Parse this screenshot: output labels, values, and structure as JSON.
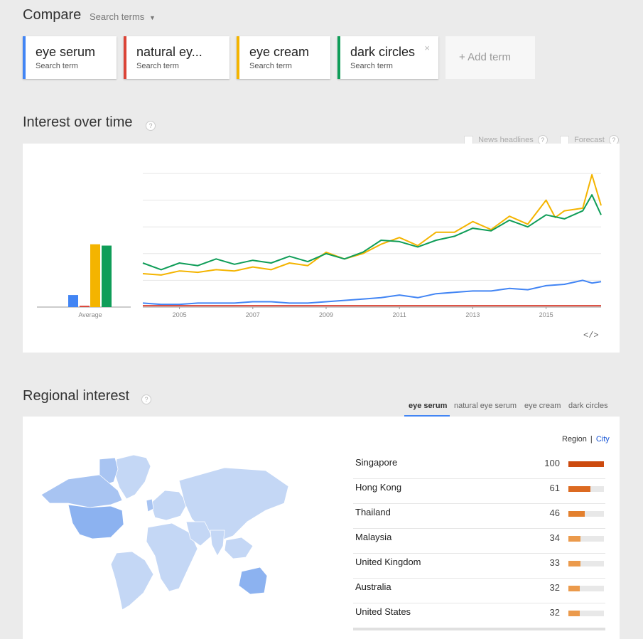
{
  "header": {
    "title": "Compare",
    "search_terms_label": "Search terms"
  },
  "terms": [
    {
      "name": "eye serum",
      "type": "Search term",
      "color": "#4285f4"
    },
    {
      "name": "natural ey...",
      "type": "Search term",
      "color": "#db4437"
    },
    {
      "name": "eye cream",
      "type": "Search term",
      "color": "#f4b400"
    },
    {
      "name": "dark circles",
      "type": "Search term",
      "color": "#0f9d58",
      "close": "×"
    }
  ],
  "add_term_label": "+ Add term",
  "interest": {
    "title": "Interest over time",
    "help": "?",
    "news_headlines_label": "News headlines",
    "forecast_label": "Forecast",
    "embed_icon": "</>"
  },
  "chart_data": {
    "type": "line",
    "xlabel": "",
    "ylabel": "",
    "x_ticks": [
      "2005",
      "2007",
      "2009",
      "2011",
      "2013",
      "2015"
    ],
    "x_range": [
      2004.0,
      2016.5
    ],
    "ylim": [
      0,
      100
    ],
    "grid": true,
    "average": {
      "label": "Average",
      "values": [
        9,
        1,
        47,
        46
      ]
    },
    "series": [
      {
        "name": "eye serum",
        "color": "#4285f4",
        "x": [
          2004.0,
          2004.5,
          2005.0,
          2005.5,
          2006.0,
          2006.5,
          2007.0,
          2007.5,
          2008.0,
          2008.5,
          2009.0,
          2009.5,
          2010.0,
          2010.5,
          2011.0,
          2011.5,
          2012.0,
          2012.5,
          2013.0,
          2013.5,
          2014.0,
          2014.5,
          2015.0,
          2015.5,
          2016.0,
          2016.25,
          2016.5
        ],
        "y": [
          3,
          2,
          2,
          3,
          3,
          3,
          4,
          4,
          3,
          3,
          4,
          5,
          6,
          7,
          9,
          7,
          10,
          11,
          12,
          12,
          14,
          13,
          16,
          17,
          20,
          18,
          19
        ]
      },
      {
        "name": "natural eye serum",
        "color": "#db4437",
        "x": [
          2004.0,
          2016.5
        ],
        "y": [
          1,
          1
        ]
      },
      {
        "name": "eye cream",
        "color": "#f4b400",
        "x": [
          2004.0,
          2004.5,
          2005.0,
          2005.5,
          2006.0,
          2006.5,
          2007.0,
          2007.5,
          2008.0,
          2008.5,
          2009.0,
          2009.5,
          2010.0,
          2010.5,
          2011.0,
          2011.5,
          2012.0,
          2012.5,
          2013.0,
          2013.5,
          2014.0,
          2014.5,
          2015.0,
          2015.25,
          2015.5,
          2016.0,
          2016.25,
          2016.5
        ],
        "y": [
          25,
          24,
          27,
          26,
          28,
          27,
          30,
          28,
          33,
          31,
          41,
          36,
          40,
          47,
          52,
          46,
          56,
          56,
          64,
          58,
          68,
          62,
          80,
          67,
          72,
          74,
          99,
          76
        ]
      },
      {
        "name": "dark circles",
        "color": "#0f9d58",
        "x": [
          2004.0,
          2004.5,
          2005.0,
          2005.5,
          2006.0,
          2006.5,
          2007.0,
          2007.5,
          2008.0,
          2008.5,
          2009.0,
          2009.5,
          2010.0,
          2010.5,
          2011.0,
          2011.5,
          2012.0,
          2012.5,
          2013.0,
          2013.5,
          2014.0,
          2014.5,
          2015.0,
          2015.5,
          2016.0,
          2016.25,
          2016.5
        ],
        "y": [
          33,
          28,
          33,
          31,
          36,
          32,
          35,
          33,
          38,
          34,
          40,
          36,
          41,
          50,
          49,
          45,
          50,
          53,
          59,
          57,
          65,
          60,
          69,
          66,
          72,
          84,
          69
        ]
      }
    ]
  },
  "regional": {
    "title": "Regional interest",
    "help": "?",
    "tabs": [
      "eye serum",
      "natural eye serum",
      "eye cream",
      "dark circles"
    ],
    "active_tab": 0,
    "region_label": "Region",
    "city_label": "City",
    "rows": [
      {
        "name": "Singapore",
        "value": 100,
        "color": "#cc4a0e"
      },
      {
        "name": "Hong Kong",
        "value": 61,
        "color": "#dc6a21"
      },
      {
        "name": "Thailand",
        "value": 46,
        "color": "#e3802e"
      },
      {
        "name": "Malaysia",
        "value": 34,
        "color": "#eb9a4c"
      },
      {
        "name": "United Kingdom",
        "value": 33,
        "color": "#eb9a4c"
      },
      {
        "name": "Australia",
        "value": 32,
        "color": "#eb9a4c"
      },
      {
        "name": "United States",
        "value": 32,
        "color": "#eb9a4c"
      }
    ],
    "map_colors": {
      "land": "#c4d7f5",
      "highlight": "#8cb2f0",
      "mid": "#a8c4f2"
    }
  }
}
